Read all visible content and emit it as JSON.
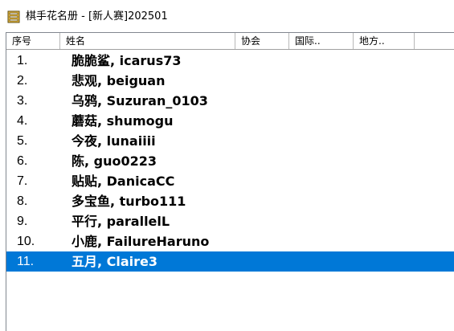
{
  "window": {
    "title": "棋手花名册 - [新人赛]202501",
    "icon": "registry-book-icon"
  },
  "table": {
    "columns": [
      "序号",
      "姓名",
      "协会",
      "国际..",
      "地方.."
    ],
    "rows": [
      {
        "index": "1.",
        "name": "脆脆鲨, icarus73"
      },
      {
        "index": "2.",
        "name": "悲观, beiguan"
      },
      {
        "index": "3.",
        "name": "乌鸦, Suzuran_0103"
      },
      {
        "index": "4.",
        "name": "蘑菇, shumogu"
      },
      {
        "index": "5.",
        "name": "今夜, lunaiiii"
      },
      {
        "index": "6.",
        "name": "陈, guo0223"
      },
      {
        "index": "7.",
        "name": "贴贴, DanicaCC"
      },
      {
        "index": "8.",
        "name": "多宝鱼, turbo111"
      },
      {
        "index": "9.",
        "name": "平行, parallelL"
      },
      {
        "index": "10.",
        "name": "小鹿, FailureHaruno"
      },
      {
        "index": "11.",
        "name": "五月, Claire3"
      }
    ],
    "selected_row": 11
  },
  "colors": {
    "selection": "#0078d7",
    "selection_text": "#ffffff"
  }
}
